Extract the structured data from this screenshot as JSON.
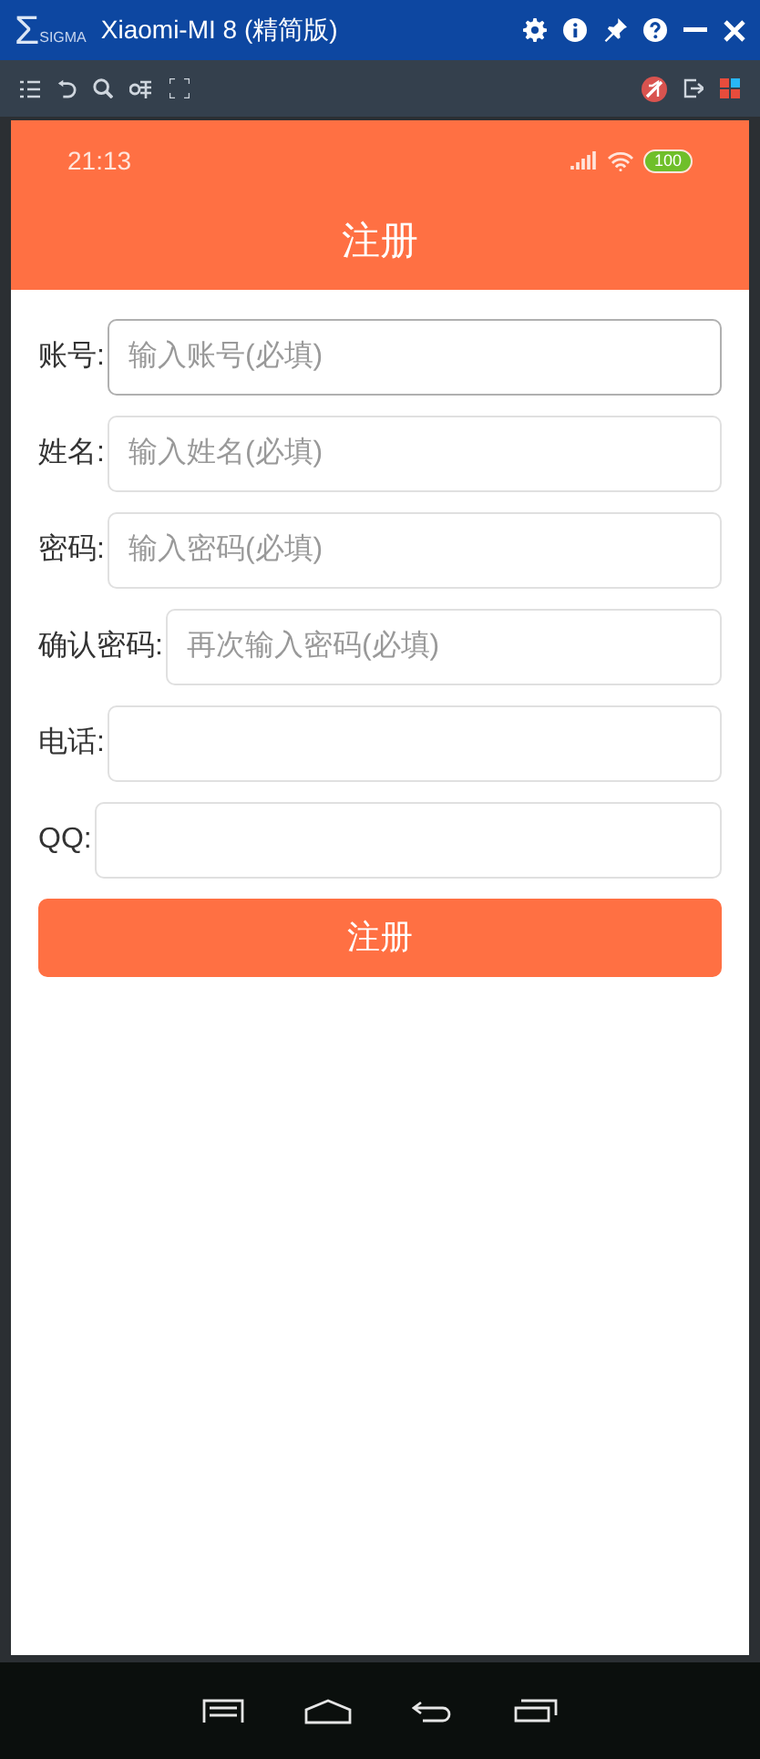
{
  "window": {
    "logo_symbol": "Σ",
    "logo_text": "SIGMA",
    "title": "Xiaomi-MI 8 (精简版)"
  },
  "status_bar": {
    "time": "21:13",
    "battery": "100"
  },
  "header": {
    "title": "注册"
  },
  "form": {
    "fields": [
      {
        "label": "账号:",
        "placeholder": "输入账号(必填)",
        "focused": true
      },
      {
        "label": "姓名:",
        "placeholder": "输入姓名(必填)",
        "focused": false
      },
      {
        "label": "密码:",
        "placeholder": "输入密码(必填)",
        "focused": false
      },
      {
        "label": "确认密码:",
        "placeholder": "再次输入密码(必填)",
        "focused": false
      },
      {
        "label": "电话:",
        "focused": false
      },
      {
        "label": "QQ:",
        "focused": false
      }
    ],
    "submit": "注册"
  }
}
